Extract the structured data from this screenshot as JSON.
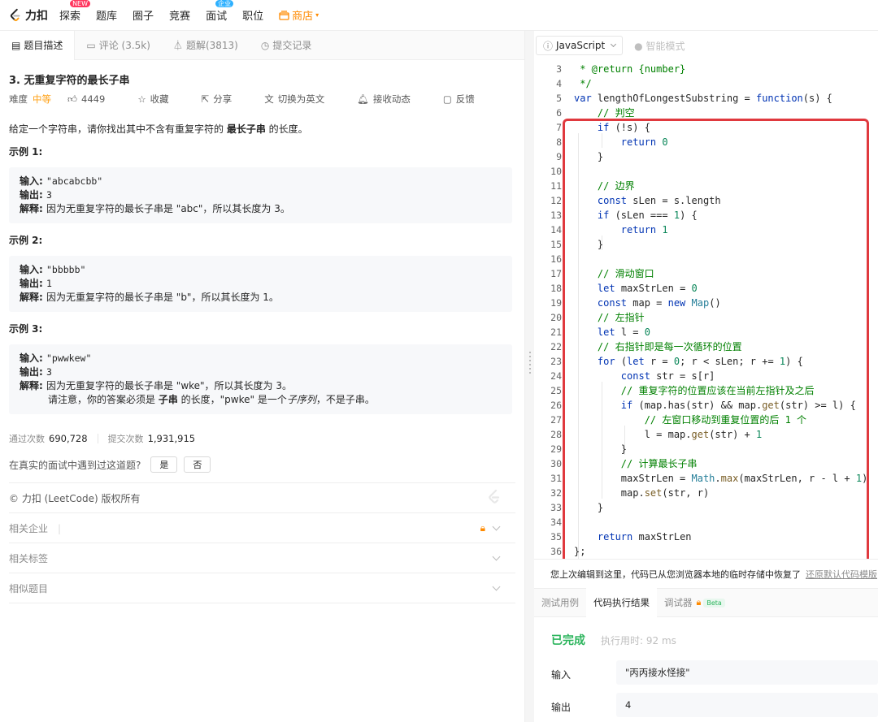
{
  "nav": {
    "brand": "力扣",
    "items": [
      {
        "label": "探索",
        "badge": "NEW"
      },
      {
        "label": "题库"
      },
      {
        "label": "圈子"
      },
      {
        "label": "竞赛"
      },
      {
        "label": "面试",
        "badge": "企业"
      },
      {
        "label": "职位"
      },
      {
        "label": "商店",
        "accent": "#ff8a00"
      }
    ]
  },
  "left_tabs": [
    {
      "label": "题目描述",
      "icon": "description-icon"
    },
    {
      "label": "评论 (3.5k)",
      "icon": "comment-icon"
    },
    {
      "label": "题解(3813)",
      "icon": "flask-icon"
    },
    {
      "label": "提交记录",
      "icon": "clock-icon"
    }
  ],
  "problem": {
    "title": "3. 无重复字符的最长子串",
    "difficulty_label": "难度",
    "difficulty": "中等",
    "likes": "4449",
    "actions": [
      "收藏",
      "分享",
      "切换为英文",
      "接收动态",
      "反馈"
    ],
    "description_prefix": "给定一个字符串，请你找出其中不含有重复字符的 ",
    "description_bold": "最长子串",
    "description_suffix": " 的长度。",
    "examples": [
      {
        "title": "示例 1:",
        "input": "\"abcabcbb\"",
        "output": "3",
        "explanation": "因为无重复字符的最长子串是 \"abc\"，所以其长度为 3。"
      },
      {
        "title": "示例 2:",
        "input": "\"bbbbb\"",
        "output": "1",
        "explanation": "因为无重复字符的最长子串是 \"b\"，所以其长度为 1。"
      },
      {
        "title": "示例 3:",
        "input": "\"pwwkew\"",
        "output": "3",
        "explanation": "因为无重复字符的最长子串是 \"wke\"，所以其长度为 3。",
        "note_prefix": "请注意，你的答案必须是 ",
        "note_bold": "子串",
        "note_mid": " 的长度，\"pwke\" 是一个",
        "note_italic": "子序列",
        "note_suffix": "，不是子串。"
      }
    ],
    "labels": {
      "input": "输入: ",
      "output": "输出: ",
      "explanation": "解释: "
    },
    "stats": {
      "accepted_label": "通过次数",
      "accepted": "690,728",
      "submitted_label": "提交次数",
      "submitted": "1,931,915"
    },
    "interview_q": "在真实的面试中遇到过这道题?",
    "yes": "是",
    "no": "否",
    "copyright": "© 力扣 (LeetCode) 版权所有",
    "sections": [
      "相关企业",
      "相关标签",
      "相似题目"
    ]
  },
  "editor": {
    "language": "JavaScript",
    "smart_mode": "智能模式",
    "restore_msg": "您上次编辑到这里，代码已从您浏览器本地的临时存储中恢复了",
    "restore_link": "还原默认代码模版"
  },
  "result_tabs": [
    "测试用例",
    "代码执行结果",
    "调试器",
    "Beta"
  ],
  "result": {
    "status": "已完成",
    "runtime": "执行用时: 92 ms",
    "input_label": "输入",
    "input_value": "\"丙丙接水怪接\"",
    "output_label": "输出",
    "output_value": "4"
  },
  "colors": {
    "accent": "#ffa116",
    "success": "#2db55d",
    "highlight": "#e0393e"
  }
}
